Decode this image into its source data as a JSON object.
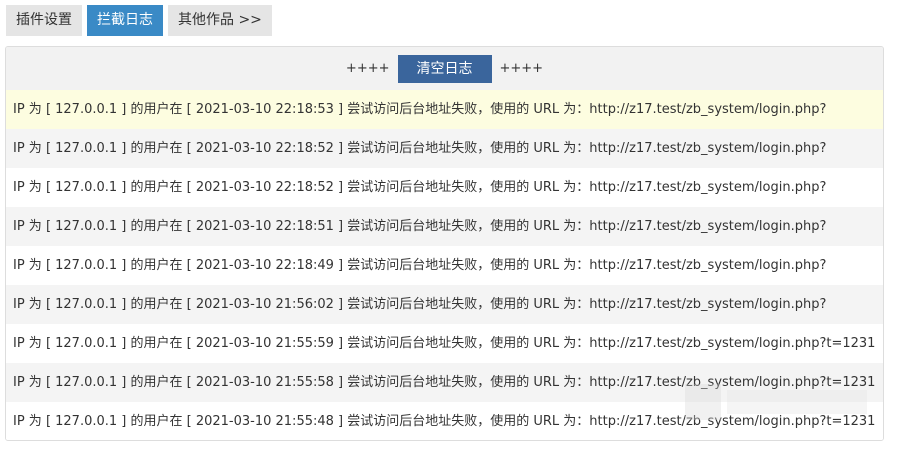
{
  "tabs": [
    {
      "label": "插件设置",
      "active": false
    },
    {
      "label": "拦截日志",
      "active": true
    },
    {
      "label": "其他作品 >>",
      "active": false
    }
  ],
  "toolbar": {
    "left_decor": "++++",
    "clear_label": "清空日志",
    "right_decor": "++++"
  },
  "logs": [
    "IP 为 [ 127.0.0.1 ] 的用户在 [ 2021-03-10 22:18:53 ] 尝试访问后台地址失败，使用的 URL 为：http://z17.test/zb_system/login.php?",
    "IP 为 [ 127.0.0.1 ] 的用户在 [ 2021-03-10 22:18:52 ] 尝试访问后台地址失败，使用的 URL 为：http://z17.test/zb_system/login.php?",
    "IP 为 [ 127.0.0.1 ] 的用户在 [ 2021-03-10 22:18:52 ] 尝试访问后台地址失败，使用的 URL 为：http://z17.test/zb_system/login.php?",
    "IP 为 [ 127.0.0.1 ] 的用户在 [ 2021-03-10 22:18:51 ] 尝试访问后台地址失败，使用的 URL 为：http://z17.test/zb_system/login.php?",
    "IP 为 [ 127.0.0.1 ] 的用户在 [ 2021-03-10 22:18:49 ] 尝试访问后台地址失败，使用的 URL 为：http://z17.test/zb_system/login.php?",
    "IP 为 [ 127.0.0.1 ] 的用户在 [ 2021-03-10 21:56:02 ] 尝试访问后台地址失败，使用的 URL 为：http://z17.test/zb_system/login.php?",
    "IP 为 [ 127.0.0.1 ] 的用户在 [ 2021-03-10 21:55:59 ] 尝试访问后台地址失败，使用的 URL 为：http://z17.test/zb_system/login.php?t=1231",
    "IP 为 [ 127.0.0.1 ] 的用户在 [ 2021-03-10 21:55:58 ] 尝试访问后台地址失败，使用的 URL 为：http://z17.test/zb_system/login.php?t=1231",
    "IP 为 [ 127.0.0.1 ] 的用户在 [ 2021-03-10 21:55:48 ] 尝试访问后台地址失败，使用的 URL 为：http://z17.test/zb_system/login.php?t=1231"
  ],
  "colors": {
    "active_tab": "#3a8ac6",
    "clear_button": "#3a659c",
    "highlight_row": "#fdfde0"
  }
}
